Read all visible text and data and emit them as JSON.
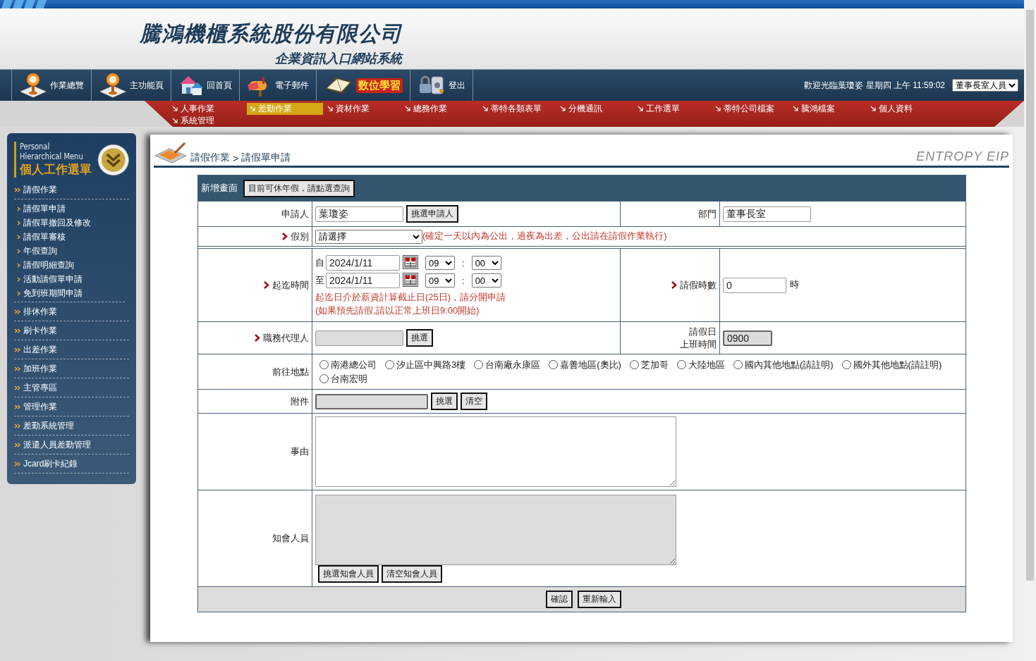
{
  "header": {
    "company_name": "騰鴻機櫃系統股份有限公司",
    "system_name": "企業資訊入口網站系統"
  },
  "toolbar": {
    "items": [
      {
        "label": "作業總覽",
        "kind": "pin"
      },
      {
        "label": "主功能頁",
        "kind": "pin"
      },
      {
        "label": "回首頁",
        "kind": "house"
      },
      {
        "label": "電子郵件",
        "kind": "mailbox"
      },
      {
        "label": "数位學習",
        "kind": "book"
      },
      {
        "label": "登出",
        "kind": "lock"
      }
    ],
    "welcome": "歡迎光臨葉瓊姿 星期四 上午 11:59:02",
    "role": "董事長室人員"
  },
  "menu": {
    "items": [
      {
        "label": "人事作業",
        "selected": false
      },
      {
        "label": "差勤作業",
        "selected": true
      },
      {
        "label": "資材作業",
        "selected": false
      },
      {
        "label": "總務作業",
        "selected": false
      },
      {
        "label": "蒂特各類表單",
        "selected": false
      },
      {
        "label": "分機通訊",
        "selected": false
      },
      {
        "label": "工作選單",
        "selected": false
      },
      {
        "label": "蒂特公司檔案",
        "selected": false
      },
      {
        "label": "騰鴻檔案",
        "selected": false
      },
      {
        "label": "個人資料",
        "selected": false
      },
      {
        "label": "系統管理",
        "selected": false
      }
    ]
  },
  "sidebar": {
    "title_en": [
      "Personal",
      "Hierarchical Menu"
    ],
    "title_zh": "個人工作選單",
    "items": [
      {
        "label": "請假作業",
        "children": [
          {
            "label": "請假單申請"
          },
          {
            "label": "請假單撤回及修改"
          },
          {
            "label": "請假單審核"
          },
          {
            "label": "年假查詢"
          },
          {
            "label": "請假明細查詢"
          },
          {
            "label": "活動請假單申請"
          },
          {
            "label": "免到班期間申請"
          }
        ]
      },
      {
        "label": "排休作業"
      },
      {
        "label": "刷卡作業"
      },
      {
        "label": "出差作業"
      },
      {
        "label": "加班作業"
      },
      {
        "label": "主管專區"
      },
      {
        "label": "管理作業"
      },
      {
        "label": "差勤系統管理"
      },
      {
        "label": "派遣人員差勤管理"
      },
      {
        "label": "Jcard刷卡紀錄"
      }
    ]
  },
  "content": {
    "breadcrumb": [
      "請假作業",
      ">",
      "請假單申請"
    ],
    "brand": "ENTROPY EIP"
  },
  "form": {
    "title": "新增畫面",
    "title_button": "目前可休年假，請點選查詢",
    "applicant": {
      "label": "申請人",
      "value": "葉瓊姿",
      "button": "挑選申請人"
    },
    "department": {
      "label": "部門",
      "value": "董事長室"
    },
    "leave_type": {
      "label": "假別",
      "required": true,
      "value": "請選擇",
      "note": "(確定一天以內為公出，過夜為出差，公出請在請假作業執行)"
    },
    "period": {
      "label": "起迄時間",
      "required": true,
      "from": {
        "prefix": "自",
        "date": "2024/1/11",
        "hour": "09",
        "minute": "00"
      },
      "to": {
        "prefix": "至",
        "date": "2024/1/11",
        "hour": "09",
        "minute": "00"
      },
      "separator": ":",
      "warnings": [
        "起迄日介於薪資計算截止日(25日)，請分開申請",
        "(如果預先請假,請以正常上班日9:00開始)"
      ]
    },
    "hours": {
      "label": "請假時數",
      "required": true,
      "value": "0",
      "unit": "時"
    },
    "proxy": {
      "label": "職務代理人",
      "required": true,
      "button": "挑選"
    },
    "work_start": {
      "label": [
        "請假日",
        "上班時間"
      ],
      "value": "0900"
    },
    "destination": {
      "label": "前往地點",
      "options": [
        {
          "label": "南港總公司",
          "selected": false
        },
        {
          "label": "汐止區中興路3樓",
          "selected": false
        },
        {
          "label": "台南廠永康區",
          "selected": false
        },
        {
          "label": "嘉善地區(奧比)",
          "selected": false
        },
        {
          "label": "芝加哥",
          "selected": false
        },
        {
          "label": "大陸地區",
          "selected": false
        },
        {
          "label": "國內其他地點(請註明)",
          "selected": false
        },
        {
          "label": "國外其他地點(請註明)",
          "selected": false
        },
        {
          "label": "台南宏明",
          "selected": false
        }
      ]
    },
    "attachment": {
      "label": "附件",
      "buttons": [
        "挑選",
        "清空"
      ]
    },
    "reason": {
      "label": "事由"
    },
    "notify": {
      "label": "知會人員",
      "buttons": [
        "挑選知會人員",
        "清空知會人員"
      ]
    },
    "actions": [
      "確認",
      "重新輸入"
    ]
  }
}
